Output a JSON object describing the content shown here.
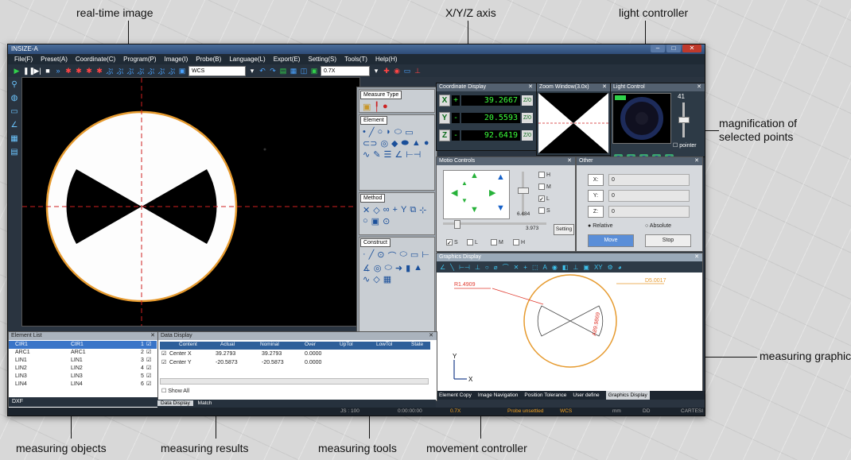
{
  "callouts": {
    "realtime": "real-time image",
    "xyz": "X/Y/Z axis",
    "light": "light controller",
    "magnification": "magnification of selected points",
    "measuring_graphic": "measuring graphic",
    "objects": "measuring objects",
    "results": "measuring results",
    "tools": "measuring tools",
    "movement": "movement controller"
  },
  "window": {
    "title": "INSIZE-A",
    "menu": [
      "File(F)",
      "Preset(A)",
      "Coordinate(C)",
      "Program(P)",
      "Image(I)",
      "Probe(B)",
      "Language(L)",
      "Export(E)",
      "Setting(S)",
      "Tools(T)",
      "Help(H)"
    ],
    "coord_select": "WCS",
    "zoom_select": "0.7X"
  },
  "tools_panel": {
    "measure_type": "Measure Type",
    "element": "Element",
    "method": "Method",
    "construct": "Construct"
  },
  "coordinate_display": {
    "title": "Coordinate Display",
    "rows": [
      {
        "axis": "X",
        "sign": "+",
        "value": "39.2667"
      },
      {
        "axis": "Y",
        "sign": "-",
        "value": "20.5593"
      },
      {
        "axis": "Z",
        "sign": "-",
        "value": "92.6419"
      }
    ]
  },
  "zoom_window": {
    "title": "Zoom Window(3.0x)"
  },
  "light_control": {
    "title": "Light Control",
    "value": "41",
    "pointer": "pointer"
  },
  "motion_controller": {
    "title": "Motio Controls",
    "speed_value": "6.484",
    "step_value": "3.973",
    "setting": "Setting",
    "checks_right": [
      "H",
      "M",
      "L",
      "S"
    ],
    "checks_bottom": [
      "S",
      "L",
      "M",
      "H"
    ]
  },
  "other": {
    "title": "Other",
    "x_label": "X:",
    "x_value": "0",
    "y_label": "Y:",
    "y_value": "0",
    "z_label": "Z:",
    "z_value": "0",
    "relative": "Relative",
    "absolute": "Absolute",
    "move": "Move",
    "stop": "Stop"
  },
  "graphics_display": {
    "title": "Graphics Display",
    "label_r": "R1.4909",
    "label_d": "D5.0017",
    "label_a": "A89.9869",
    "axis_y": "Y",
    "axis_x": "X",
    "colors": {
      "circle": "#e69a2e",
      "label_red": "#e03a2f"
    }
  },
  "bottom_tabs": [
    "Element Copy",
    "Image Navigation",
    "Position Tolerance",
    "User define",
    "Graphics Display"
  ],
  "element_list": {
    "title": "Element List",
    "rows": [
      {
        "name": "CIR1",
        "alias": "CIR1",
        "idx": "1"
      },
      {
        "name": "ARC1",
        "alias": "ARC1",
        "idx": "2"
      },
      {
        "name": "LIN1",
        "alias": "LIN1",
        "idx": "3"
      },
      {
        "name": "LIN2",
        "alias": "LIN2",
        "idx": "4"
      },
      {
        "name": "LIN3",
        "alias": "LIN3",
        "idx": "5"
      },
      {
        "name": "LIN4",
        "alias": "LIN4",
        "idx": "6"
      }
    ],
    "footer": "DXF"
  },
  "data_display": {
    "title": "Data Display",
    "headers": [
      "Content",
      "Actual",
      "Nominal",
      "Over",
      "UpTol",
      "LowTol",
      "State"
    ],
    "rows": [
      {
        "content": "Center X",
        "actual": "39.2793",
        "nominal": "39.2793",
        "over": "0.0000"
      },
      {
        "content": "Center Y",
        "actual": "-20.5873",
        "nominal": "-20.5873",
        "over": "0.0000"
      }
    ],
    "show_all": "Show All",
    "tabs": [
      "Data Display",
      "Match"
    ]
  },
  "status_bar": {
    "js": "JS : 100",
    "time": "0:00:00:00",
    "zoom": "0.7X",
    "probe": "Probe unsettled",
    "coord": "WCS",
    "unit": "mm",
    "angle": "DD",
    "system": "CARTESI"
  }
}
